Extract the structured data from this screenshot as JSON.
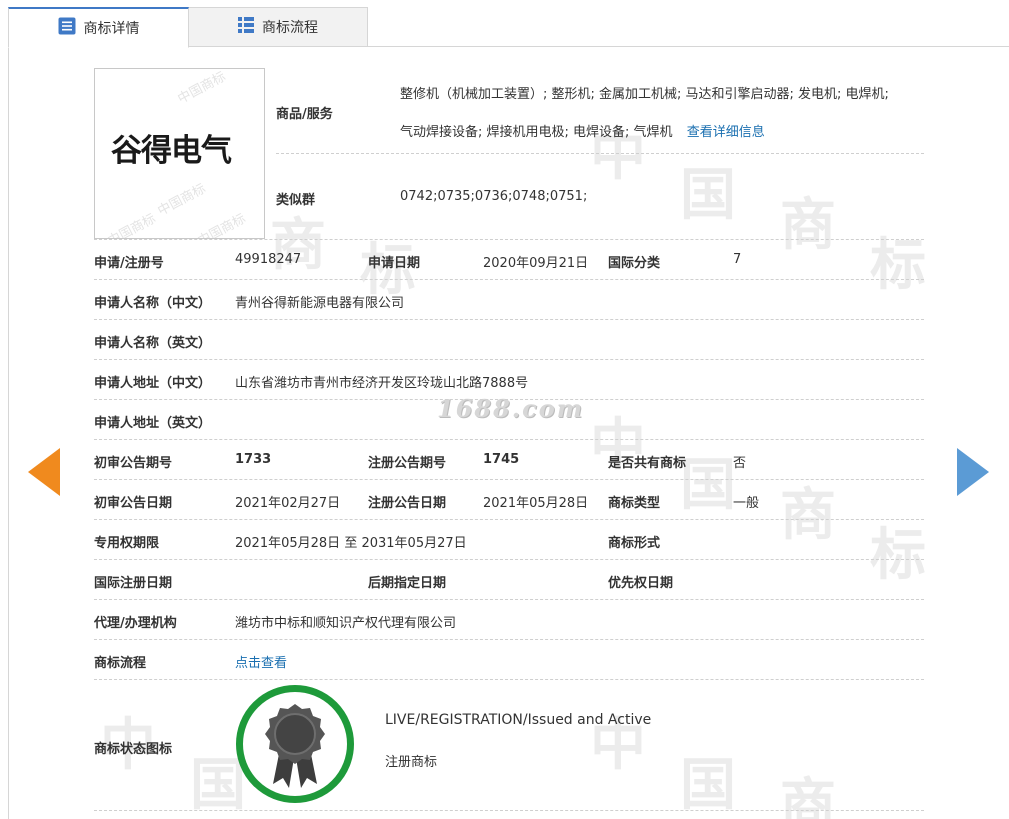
{
  "tabs": [
    {
      "label": "商标详情",
      "icon": "list-icon",
      "active": true
    },
    {
      "label": "商标流程",
      "icon": "grid-icon",
      "active": false
    }
  ],
  "logo": {
    "text": "谷得电气",
    "watermark": "中国商标"
  },
  "watermark": {
    "site": "1688.com",
    "chars": [
      "中",
      "国",
      "商",
      "标"
    ]
  },
  "goods": {
    "label": "商品/服务",
    "line1": "整修机（机械加工装置）; 整形机; 金属加工机械; 马达和引擎启动器; 发电机; 电焊机;",
    "line2": "气动焊接设备; 焊接机用电极; 电焊设备; 气焊机",
    "detail_link": "查看详细信息"
  },
  "similar": {
    "label": "类似群",
    "value": "0742;0735;0736;0748;0751;"
  },
  "fields": {
    "reg_no": {
      "label": "申请/注册号",
      "value": "49918247"
    },
    "apply_date": {
      "label": "申请日期",
      "value": "2020年09月21日"
    },
    "intl_class": {
      "label": "国际分类",
      "value": "7"
    },
    "applicant_cn": {
      "label": "申请人名称（中文）",
      "value": "青州谷得新能源电器有限公司"
    },
    "applicant_en": {
      "label": "申请人名称（英文）",
      "value": ""
    },
    "address_cn": {
      "label": "申请人地址（中文）",
      "value": "山东省潍坊市青州市经济开发区玲珑山北路7888号"
    },
    "address_en": {
      "label": "申请人地址（英文）",
      "value": ""
    },
    "prelim_issue": {
      "label": "初审公告期号",
      "value": "1733"
    },
    "reg_issue": {
      "label": "注册公告期号",
      "value": "1745"
    },
    "shared": {
      "label": "是否共有商标",
      "value": "否"
    },
    "prelim_date": {
      "label": "初审公告日期",
      "value": "2021年02月27日"
    },
    "reg_date": {
      "label": "注册公告日期",
      "value": "2021年05月28日"
    },
    "tm_type": {
      "label": "商标类型",
      "value": "一般"
    },
    "exclusive": {
      "label": "专用权期限",
      "start": "2021年05月28日",
      "sep": "至",
      "end": "2031年05月27日"
    },
    "tm_form": {
      "label": "商标形式",
      "value": ""
    },
    "intl_reg_date": {
      "label": "国际注册日期",
      "value": ""
    },
    "later_date": {
      "label": "后期指定日期",
      "value": ""
    },
    "priority_date": {
      "label": "优先权日期",
      "value": ""
    },
    "agent": {
      "label": "代理/办理机构",
      "value": "潍坊市中标和顺知识产权代理有限公司"
    },
    "process": {
      "label": "商标流程",
      "link": "点击查看"
    },
    "status": {
      "label": "商标状态图标",
      "en": "LIVE/REGISTRATION/Issued and Active",
      "cn": "注册商标"
    }
  },
  "colors": {
    "accent": "#3f79c6",
    "link": "#1a6fb0",
    "badge_ring": "#1e9a3a",
    "arrow_left": "#f08a1e",
    "arrow_right": "#5b9bd5"
  }
}
